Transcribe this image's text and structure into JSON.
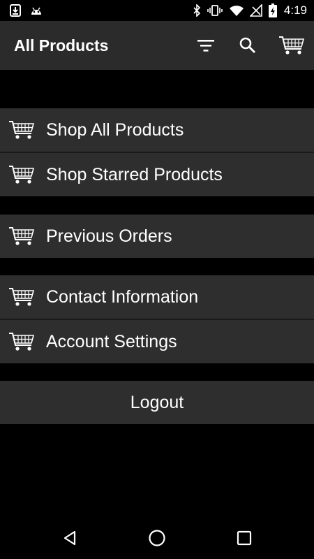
{
  "status_bar": {
    "time": "4:19",
    "left_icons": [
      "download-icon",
      "android-icon"
    ],
    "right_icons": [
      "bluetooth-icon",
      "vibrate-icon",
      "wifi-icon",
      "no-signal-icon",
      "battery-charging-icon"
    ]
  },
  "app_bar": {
    "title": "All Products",
    "actions": [
      "filter-icon",
      "search-icon",
      "cart-icon"
    ]
  },
  "menu_groups": [
    {
      "items": [
        {
          "label": "Shop All Products",
          "icon": "cart-icon"
        },
        {
          "label": "Shop Starred Products",
          "icon": "cart-icon"
        }
      ]
    },
    {
      "items": [
        {
          "label": "Previous Orders",
          "icon": "cart-icon"
        }
      ]
    },
    {
      "items": [
        {
          "label": "Contact Information",
          "icon": "cart-icon"
        },
        {
          "label": "Account Settings",
          "icon": "cart-icon"
        }
      ]
    }
  ],
  "logout_label": "Logout",
  "nav_bar": {
    "buttons": [
      "back-icon",
      "home-icon",
      "recents-icon"
    ]
  },
  "colors": {
    "background": "#000000",
    "surface": "#2e2e2e",
    "app_bar": "#2b2b2b",
    "text": "#ffffff"
  }
}
